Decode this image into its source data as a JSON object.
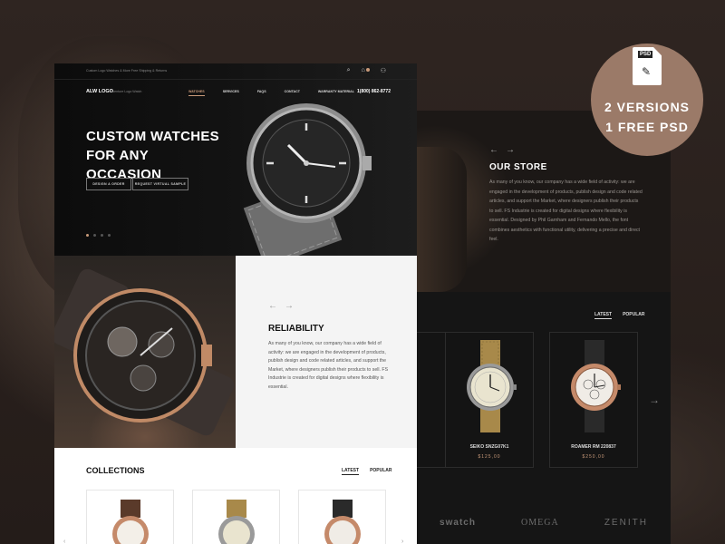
{
  "badge": {
    "file_label": "PSD",
    "line1": "2 VERSIONS",
    "line2": "1 FREE PSD",
    "icon": "psd-file-icon",
    "color": "#9b7a68"
  },
  "front": {
    "topbar": {
      "tagline": "Custom Logo Watches & More Free Shipping & Returns",
      "icons": [
        "search-icon",
        "cart-icon",
        "user-icon"
      ]
    },
    "nav": {
      "logo": "ALW LOGO",
      "logo_sub": "Aventure Logo Watch",
      "menu": [
        "WATCHES",
        "SERVICES",
        "FAQS",
        "CONTACT",
        "WARRANTY MATERIAL"
      ],
      "active_index": 0,
      "phone": "1(800) 862-8772"
    },
    "hero": {
      "title": "CUSTOM WATCHES FOR ANY OCCASION",
      "buttons": [
        "DESIGN A ORDER",
        "REQUEST VIRTUAL SAMPLE"
      ],
      "slides": 4,
      "active_slide": 1
    },
    "reliability": {
      "arrows": [
        "←",
        "→"
      ],
      "title": "RELIABILITY",
      "text": "As many of you know, our company has a wide field of activity: we are engaged in the development of products, publish design and code related articles, and support the Market, where designers publish their products to sell. FS Industrie is created for digital designs where flexibility is essential."
    },
    "collections": {
      "title": "COLLECTIONS",
      "tabs": [
        "LATEST",
        "POPULAR"
      ],
      "active_tab": 0,
      "arrows": [
        "‹",
        "›"
      ]
    }
  },
  "back": {
    "arrows": [
      "←",
      "→"
    ],
    "store_title": "OUR STORE",
    "store_text": "As many of you know, our company has a wide field of activity: we are engaged in the development of products, publish design and code related articles, and support the Market, where designers publish their products to sell. FS Industrie is created for digital designs where flexibility is essential. Designed by Phil Garnham and Fernando Mello, the font combines aesthetics with functional utility, delivering a precise and direct feel.",
    "tabs": [
      "LATEST",
      "POPULAR"
    ],
    "active_tab": 0,
    "products": [
      {
        "name": "SEIKO SNZG07K1",
        "price": "$125,00"
      },
      {
        "name": "ROAMER RM 220837",
        "price": "$250,00"
      }
    ],
    "next_arrow": "→",
    "brands": [
      "swatch",
      "OMEGA",
      "ZENITH"
    ]
  },
  "colors": {
    "accent": "#c99a7a",
    "dark": "#151515",
    "background": "#2a211d"
  }
}
